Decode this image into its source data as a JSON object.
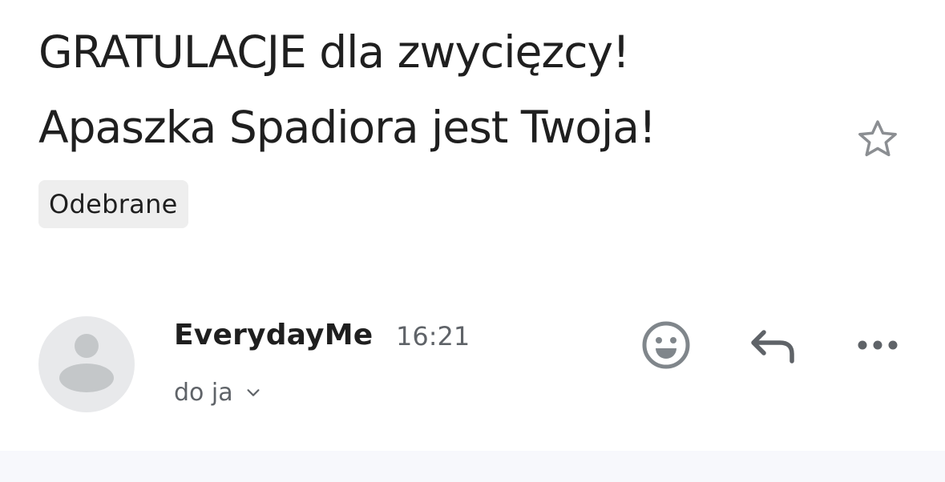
{
  "message": {
    "subject_line1": "GRATULACJE dla zwycięzcy!",
    "subject_line2": "Apaszka Spadiora jest Twoja!",
    "label": "Odebrane",
    "starred": false
  },
  "sender": {
    "name": "EverydayMe",
    "time": "16:21",
    "recipient": "do ja"
  },
  "icons": {
    "star": "star-outline-icon",
    "emoji": "emoji-reaction-icon",
    "reply": "reply-icon",
    "more": "more-horizontal-icon",
    "avatar": "default-person-avatar"
  },
  "colors": {
    "icon_gray": "#5f6368",
    "chip_bg": "#eeeeee",
    "avatar_bg": "#e8e9eb",
    "avatar_fg": "#c4c7c9"
  }
}
